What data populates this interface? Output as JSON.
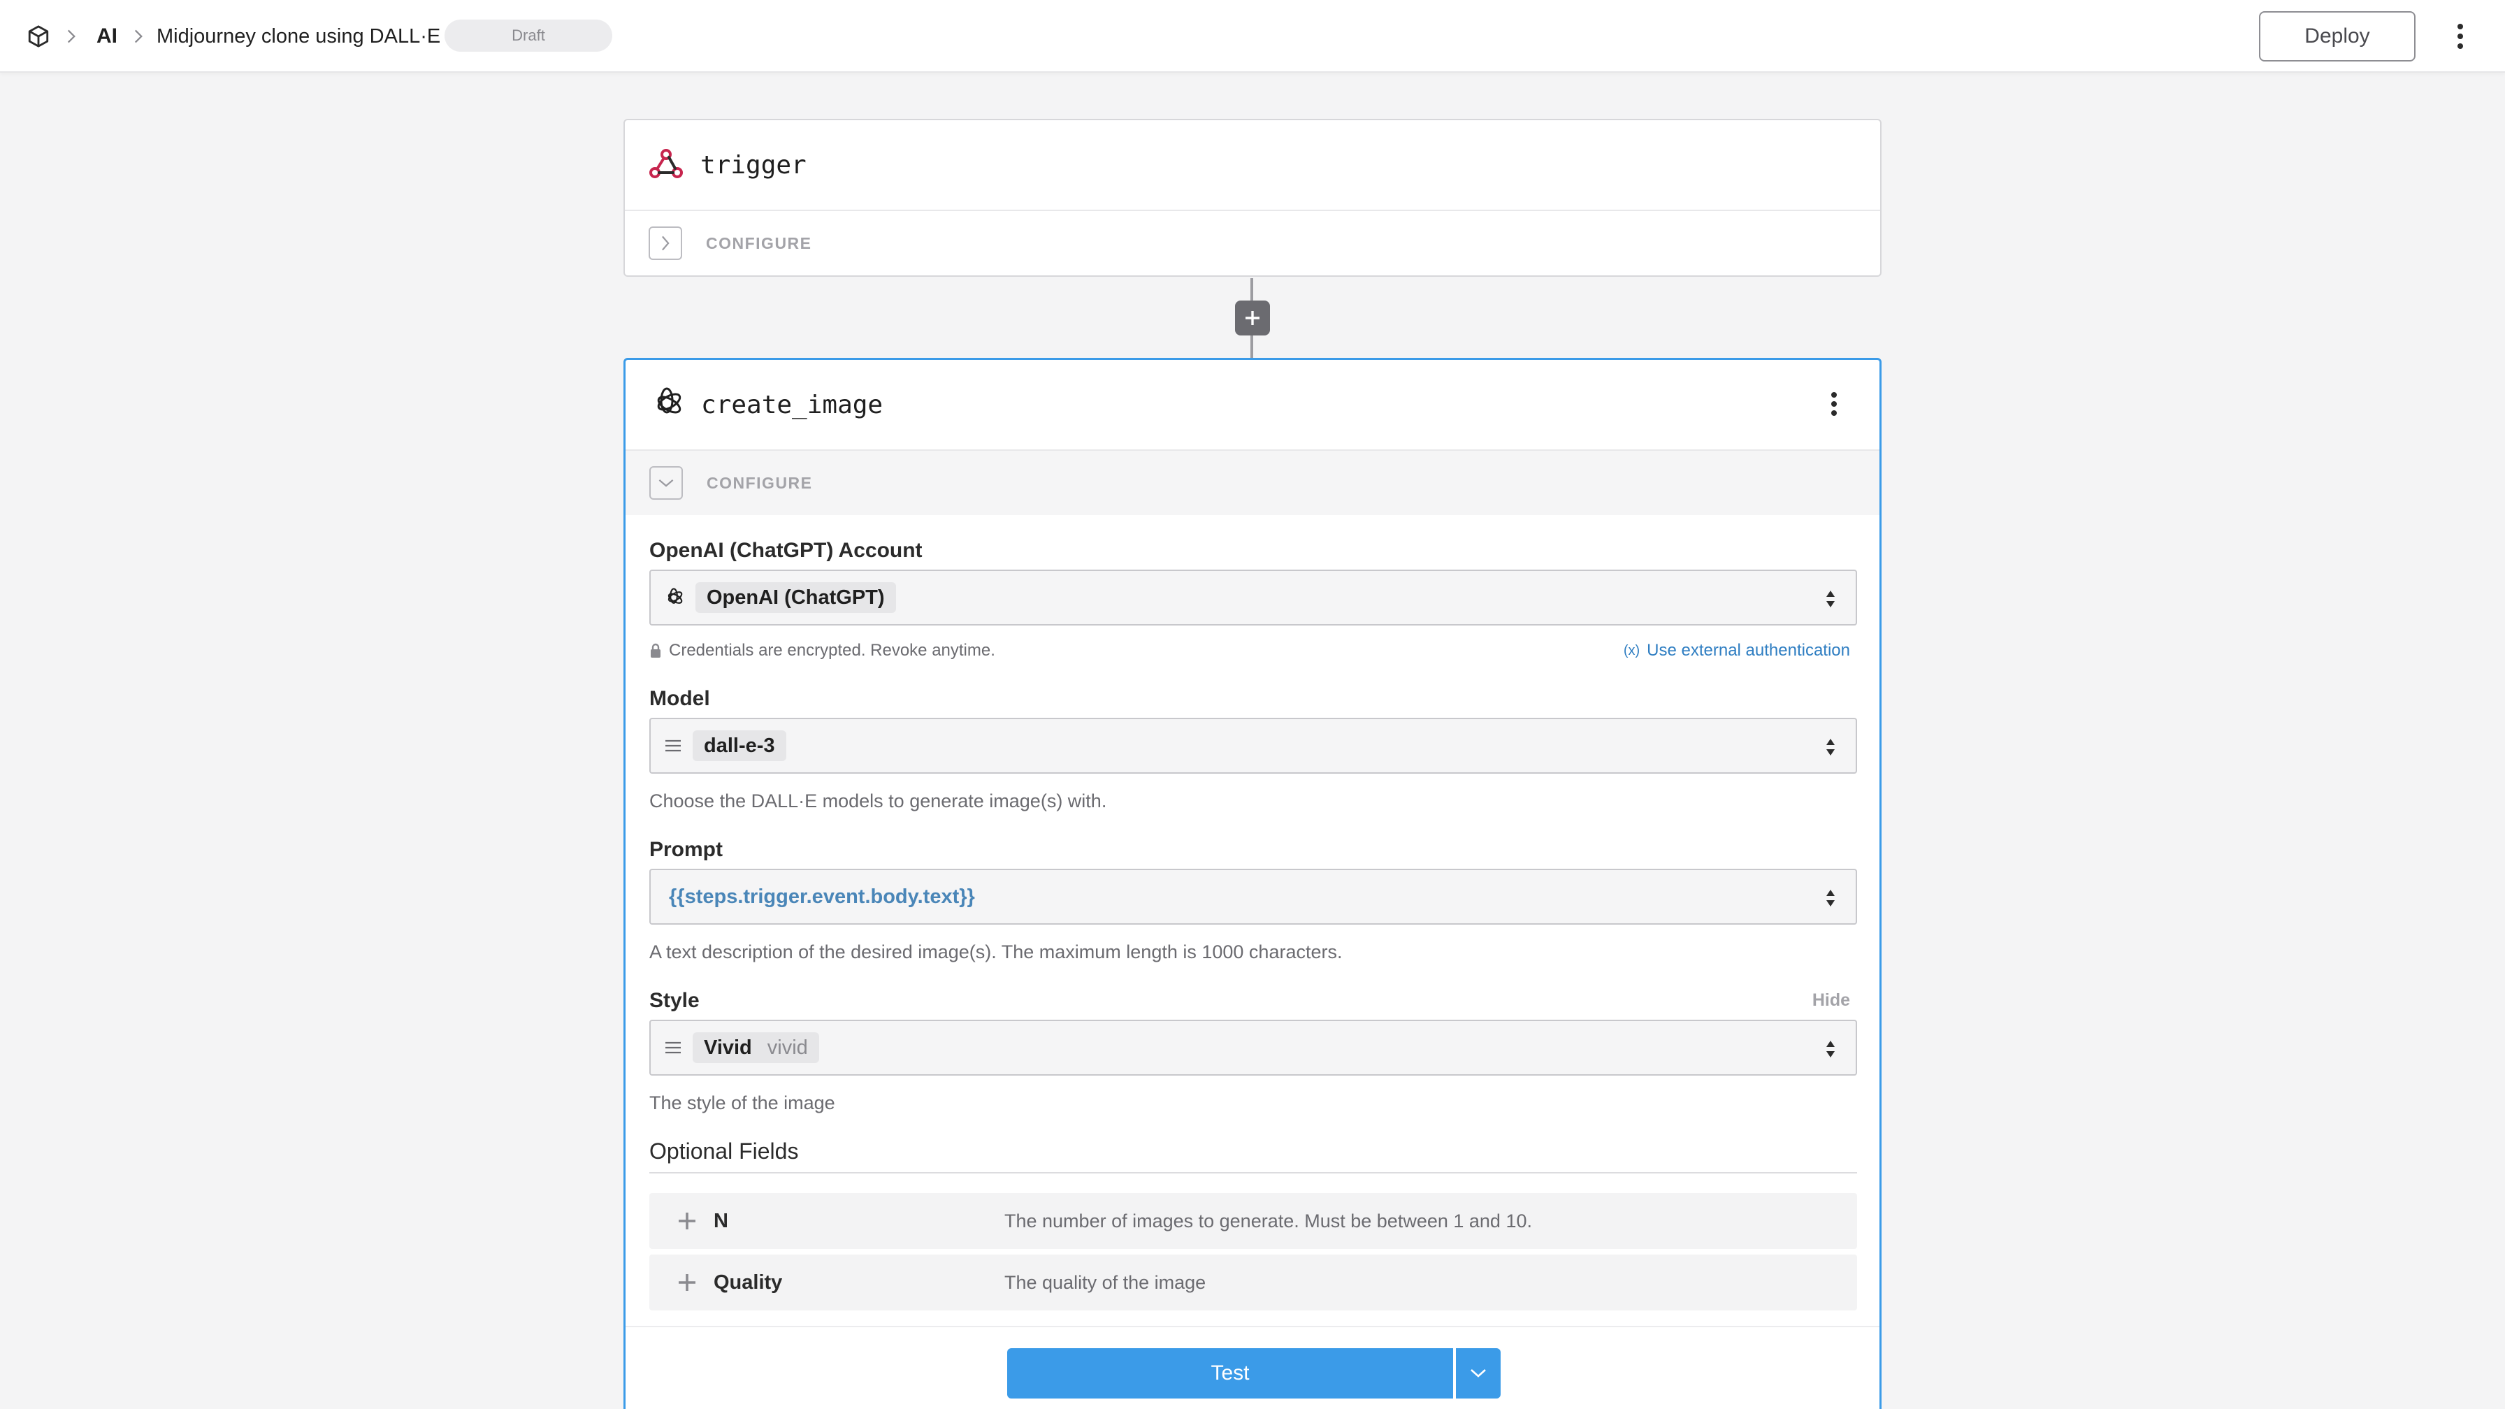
{
  "header": {
    "breadcrumb": [
      "AI",
      "Midjourney clone using DALL·E"
    ],
    "status": "Draft",
    "deploy_label": "Deploy"
  },
  "trigger_step": {
    "name": "trigger",
    "configure_label": "CONFIGURE"
  },
  "action_step": {
    "name": "create_image",
    "configure_label": "CONFIGURE",
    "account": {
      "label": "OpenAI (ChatGPT) Account",
      "value": "OpenAI (ChatGPT)",
      "note": "Credentials are encrypted. Revoke anytime.",
      "external_auth": "Use external authentication"
    },
    "model": {
      "label": "Model",
      "value": "dall-e-3",
      "hint": "Choose the DALL·E models to generate image(s) with."
    },
    "prompt": {
      "label": "Prompt",
      "value": "{{steps.trigger.event.body.text}}",
      "hint": "A text description of the desired image(s). The maximum length is 1000 characters."
    },
    "style": {
      "label": "Style",
      "hide_label": "Hide",
      "value": "Vivid",
      "value_key": "vivid",
      "hint": "The style of the image"
    },
    "optional": {
      "title": "Optional Fields",
      "fields": [
        {
          "name": "N",
          "description": "The number of images to generate. Must be between 1 and 10."
        },
        {
          "name": "Quality",
          "description": "The quality of the image"
        }
      ]
    },
    "test_label": "Test"
  },
  "colors": {
    "accent": "#3b9be8",
    "prompt_text": "#4a86b8",
    "webhook_red": "#c7254e"
  }
}
